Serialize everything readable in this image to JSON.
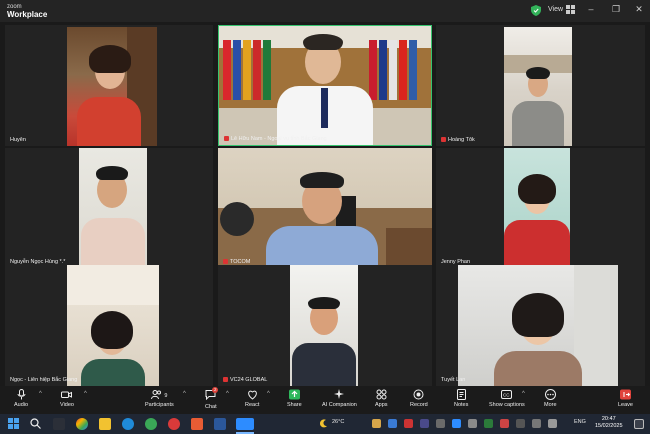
{
  "app": {
    "brand_small": "zoom",
    "brand_large": "Workplace"
  },
  "titlebar": {
    "view_label": "View"
  },
  "participants": [
    {
      "name": "Huyên"
    },
    {
      "name": "Lê Hữu Nam - Ngoại vụ tỉnh Bắc Giang"
    },
    {
      "name": "Hoàng Tôk"
    },
    {
      "name": "Nguyễn Ngọc Hùng *.*"
    },
    {
      "name": "TOCOM"
    },
    {
      "name": "Jenny Phan"
    },
    {
      "name": "Ngọc - Liên hiệp Bắc Giang"
    },
    {
      "name": "VC24 GLOBAL"
    },
    {
      "name": "Tuyết Lan"
    }
  ],
  "toolbar": {
    "audio": "Audio",
    "video": "Video",
    "participants": "Participants",
    "participants_count": "9",
    "chat": "Chat",
    "chat_badge": "2",
    "react": "React",
    "share": "Share",
    "ai_companion": "AI Companion",
    "apps": "Apps",
    "record": "Record",
    "notes": "Notes",
    "captions": "Show captions",
    "more": "More",
    "leave": "Leave"
  },
  "taskbar": {
    "weather": "26°C",
    "lang": "ENG",
    "time": "20:47",
    "date": "15/02/2025"
  },
  "colors": {
    "active_speaker": "#36c46e",
    "share_green": "#2eb85c",
    "leave_red": "#e0433b"
  }
}
